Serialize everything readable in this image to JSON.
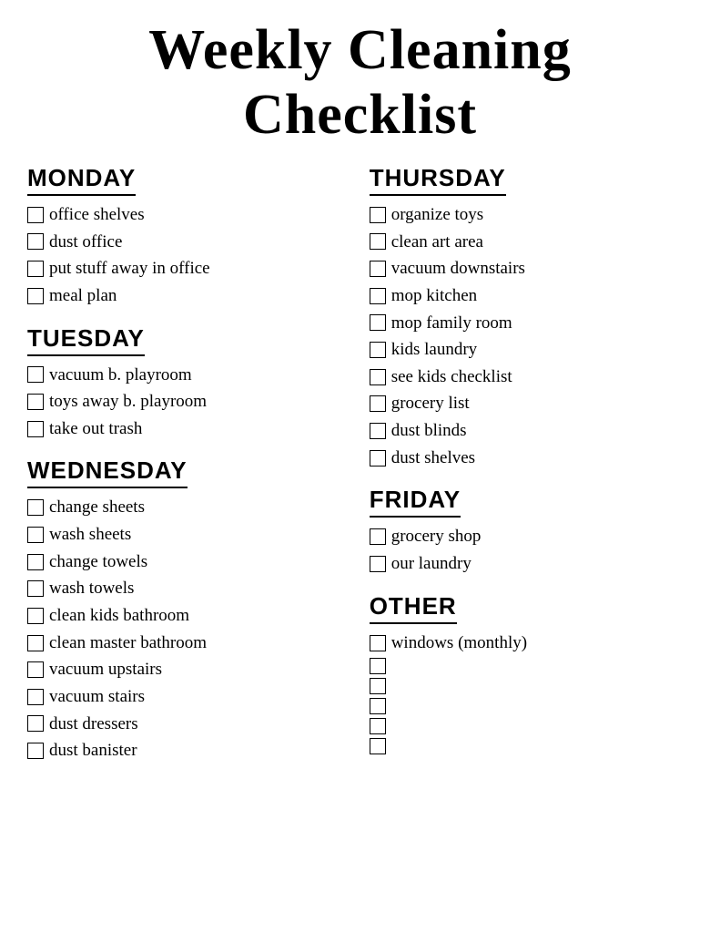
{
  "title": "Weekly Cleaning Checklist",
  "columns": {
    "left": [
      {
        "day": "MONDAY",
        "items": [
          "office shelves",
          "dust office",
          "put stuff away in office",
          "meal plan"
        ]
      },
      {
        "day": "TUESDAY",
        "items": [
          "vacuum b. playroom",
          "toys away b. playroom",
          "take out trash"
        ]
      },
      {
        "day": "WEDNESDAY",
        "items": [
          "change sheets",
          "wash sheets",
          "change towels",
          "wash towels",
          "clean kids bathroom",
          "clean master bathroom",
          "vacuum upstairs",
          "vacuum stairs",
          "dust dressers",
          "dust banister"
        ]
      }
    ],
    "right": [
      {
        "day": "THURSDAY",
        "items": [
          "organize toys",
          "clean art area",
          "vacuum downstairs",
          "mop kitchen",
          "mop family room",
          "kids laundry",
          "see kids checklist",
          "grocery list",
          "dust blinds",
          "dust shelves"
        ]
      },
      {
        "day": "FRIDAY",
        "items": [
          "grocery shop",
          "our laundry"
        ]
      },
      {
        "day": "OTHER",
        "items": [
          "windows (monthly)",
          "",
          "",
          "",
          "",
          ""
        ]
      }
    ]
  }
}
